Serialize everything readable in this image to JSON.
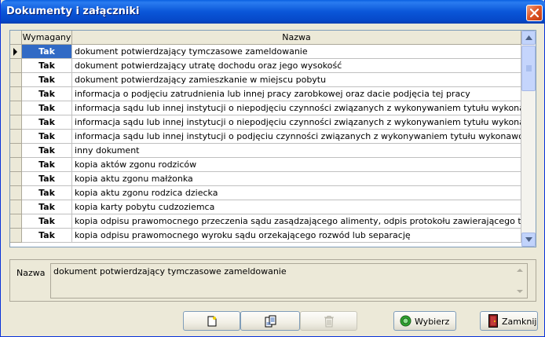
{
  "window": {
    "title": "Dokumenty i załączniki"
  },
  "grid": {
    "columns": [
      "Wymagany",
      "Nazwa"
    ],
    "rows": [
      {
        "required": "Tak",
        "name": "dokument potwierdzający tymczasowe zameldowanie",
        "selected": true
      },
      {
        "required": "Tak",
        "name": "dokument potwierdzający utratę dochodu oraz jego wysokość"
      },
      {
        "required": "Tak",
        "name": "dokument potwierdzający zamieszkanie w miejscu pobytu"
      },
      {
        "required": "Tak",
        "name": "informacja o podjęciu zatrudnienia lub innej pracy zarobkowej oraz dacie podjęcia tej pracy"
      },
      {
        "required": "Tak",
        "name": "informacja sądu lub innej instytucji o niepodjęciu czynności związanych z wykonywaniem tytułu wykonawczego za granicą"
      },
      {
        "required": "Tak",
        "name": "informacja sądu lub innej instytucji o niepodjęciu czynności związanych z wykonywaniem tytułu wykonawczego za granicą"
      },
      {
        "required": "Tak",
        "name": "informacja sądu lub innej instytucji o podjęciu czynności związanych z wykonywaniem tytułu wykonawczego za granicą"
      },
      {
        "required": "Tak",
        "name": "inny dokument"
      },
      {
        "required": "Tak",
        "name": "kopia aktów zgonu rodziców"
      },
      {
        "required": "Tak",
        "name": "kopia aktu zgonu małżonka"
      },
      {
        "required": "Tak",
        "name": "kopia aktu zgonu rodzica dziecka"
      },
      {
        "required": "Tak",
        "name": "kopia karty pobytu cudzoziemca"
      },
      {
        "required": "Tak",
        "name": "kopia odpisu prawomocnego przeczenia sądu zasądzającego alimenty, odpis protokołu zawierającego treść ugody sądowej"
      },
      {
        "required": "Tak",
        "name": "kopia odpisu prawomocnego wyroku sądu orzekającego rozwód lub separację"
      }
    ]
  },
  "detail": {
    "label": "Nazwa",
    "value": "dokument potwierdzający tymczasowe zameldowanie"
  },
  "buttons": {
    "choose_label": "Wybierz",
    "close_label": "Zamknij"
  },
  "icons": {
    "close": "close-icon",
    "new": "new-document-icon",
    "edit": "edit-document-icon",
    "delete": "trash-icon",
    "choose": "green-circle-icon",
    "exit": "exit-door-icon"
  }
}
